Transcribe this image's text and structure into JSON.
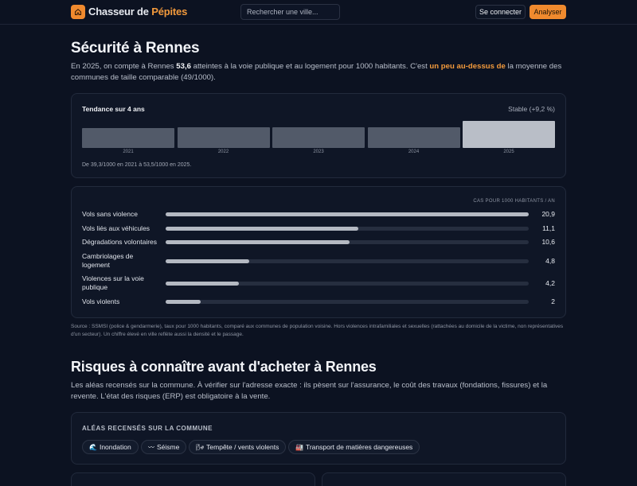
{
  "header": {
    "brand_part1": "Chasseur de ",
    "brand_part2": "Pépites",
    "search_placeholder": "Rechercher une ville...",
    "login_label": "Se connecter",
    "analyze_label": "Analyser"
  },
  "security": {
    "title": "Sécurité à Rennes",
    "intro_1": "En 2025, on compte à Rennes ",
    "intro_value": "53,6",
    "intro_2": " atteintes à la voie publique et au logement pour 1000 habitants. C'est ",
    "intro_highlight": "un peu au-dessus de",
    "intro_3": " la moyenne des communes de taille comparable (49/1000).",
    "trend": {
      "title": "Tendance sur 4 ans",
      "status": "Stable (+9,2 %)",
      "years": [
        "2021",
        "2022",
        "2023",
        "2024",
        "2025"
      ],
      "values": [
        39.3,
        41.5,
        41.5,
        41.5,
        53.5
      ],
      "note": "De 39,3/1000 en 2021 à 53,5/1000 en 2025."
    },
    "cases": {
      "unit_label": "CAS POUR 1000 HABITANTS / AN",
      "rows": [
        {
          "label": "Vols sans violence",
          "value": "20,9",
          "num": 20.9
        },
        {
          "label": "Vols liés aux véhicules",
          "value": "11,1",
          "num": 11.1
        },
        {
          "label": "Dégradations volontaires",
          "value": "10,6",
          "num": 10.6
        },
        {
          "label": "Cambriolages de logement",
          "value": "4,8",
          "num": 4.8
        },
        {
          "label": "Violences sur la voie publique",
          "value": "4,2",
          "num": 4.2
        },
        {
          "label": "Vols violents",
          "value": "2",
          "num": 2
        }
      ]
    },
    "source": "Source : SSMSI (police & gendarmerie), taux pour 1000 habitants, comparé aux communes de population voisine. Hors violences intrafamiliales et sexuelles (rattachées au domicile de la victime, non représentatives d'un secteur). Un chiffre élevé en ville reflète aussi la densité et le passage."
  },
  "risks": {
    "title": "Risques à connaître avant d'acheter à Rennes",
    "intro": "Les aléas recensés sur la commune. À vérifier sur l'adresse exacte : ils pèsent sur l'assurance, le coût des travaux (fondations, fissures) et la revente. L'état des risques (ERP) est obligatoire à la vente.",
    "card_title": "ALÉAS RECENSÉS SUR LA COMMUNE",
    "chips": [
      {
        "icon": "🌊",
        "label": "Inondation"
      },
      {
        "icon": "〰",
        "label": "Séisme"
      },
      {
        "icon": "🌬",
        "label": "Tempête / vents violents"
      },
      {
        "icon": "🏭",
        "label": "Transport de matières dangereuses"
      }
    ]
  }
}
